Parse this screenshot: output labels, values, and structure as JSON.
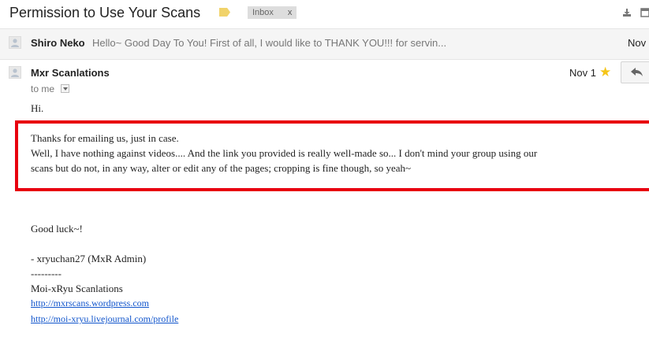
{
  "thread": {
    "subject": "Permission to Use Your Scans",
    "label_chip": "Inbox",
    "label_chip_close": "x",
    "label_color": "#f1d36a"
  },
  "collapsed_message": {
    "sender": "Shiro Neko",
    "snippet": "Hello~ Good Day To You! First of all, I would like to THANK YOU!!! for servin...",
    "date": "Nov"
  },
  "message": {
    "sender": "Mxr Scanlations",
    "to": "to me",
    "date": "Nov 1",
    "starred": true,
    "star_icon": "star-icon",
    "reply_icon": "reply-icon",
    "greeting": "Hi.",
    "highlight_line1": "Thanks for emailing us, just in case.",
    "highlight_line2": "Well, I have nothing against videos.... And the link you provided is really well-made so... I don't mind your group using our",
    "highlight_line3": "scans but do not, in any way, alter or edit any of the pages; cropping is fine though, so yeah~",
    "closing": "Good luck~!",
    "signature_name": "- xryuchan27 (MxR Admin)",
    "signature_divider": "---------",
    "signature_group": "Moi-xRyu Scanlations",
    "link1": "http://mxrscans.wordpress.com",
    "link2": "http://moi-xryu.livejournal.com/profile"
  },
  "colors": {
    "highlight_border": "#e8000e",
    "link": "#1155cc",
    "star": "#f5c518"
  }
}
